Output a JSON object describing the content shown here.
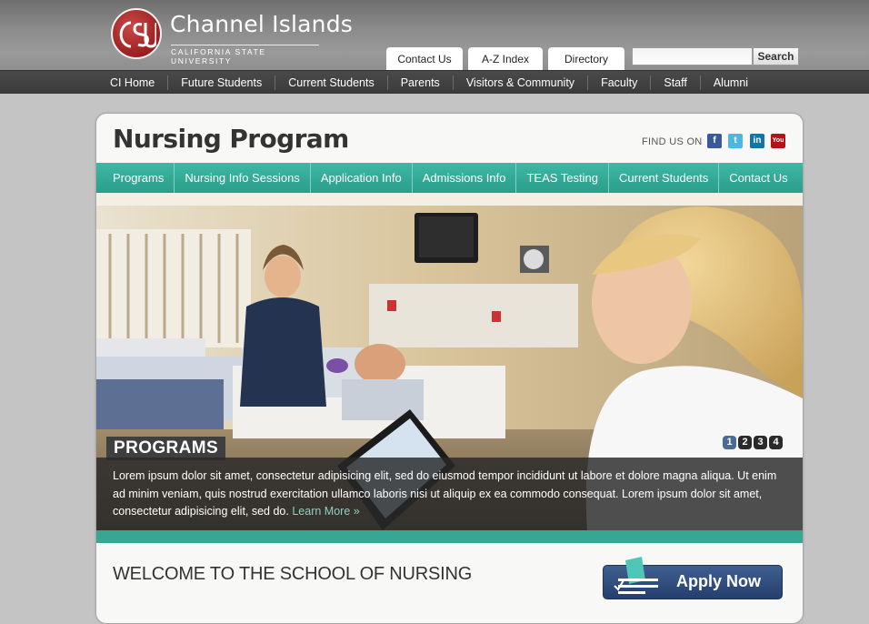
{
  "header": {
    "logo_title": "Channel Islands",
    "logo_subtitle": "CALIFORNIA STATE UNIVERSITY",
    "tabs": [
      "Contact Us",
      "A-Z Index",
      "Directory"
    ],
    "search": {
      "placeholder": "",
      "button_label": "Search"
    }
  },
  "main_nav": [
    "CI Home",
    "Future Students",
    "Current Students",
    "Parents",
    "Visitors & Community",
    "Faculty",
    "Staff",
    "Alumni"
  ],
  "page": {
    "title": "Nursing Program",
    "find_us": "FIND US ON",
    "social": [
      "facebook-icon",
      "twitter-icon",
      "linkedin-icon",
      "youtube-icon"
    ]
  },
  "sub_nav": [
    "Programs",
    "Nursing Info Sessions",
    "Application Info",
    "Admissions Info",
    "TEAS Testing",
    "Current Students",
    "Contact Us"
  ],
  "hero": {
    "label": "PROGRAMS",
    "caption": "Lorem ipsum dolor sit amet, consectetur adipisicing elit, sed do eiusmod tempor incididunt ut labore et dolore magna aliqua. Ut enim ad minim veniam, quis nostrud exercitation ullamco laboris nisi ut aliquip ex ea commodo consequat. Lorem ipsum dolor sit amet, consectetur adipisicing elit, sed do.",
    "learn_more": "Learn More »",
    "pager": [
      "1",
      "2",
      "3",
      "4"
    ],
    "active_slide": "1"
  },
  "welcome": {
    "heading": "WELCOME TO THE SCHOOL OF NURSING",
    "apply_label": "Apply Now"
  },
  "colors": {
    "teal": "#37a793",
    "brand_red": "#9b1f20",
    "apply_blue": "#2f4f82"
  }
}
